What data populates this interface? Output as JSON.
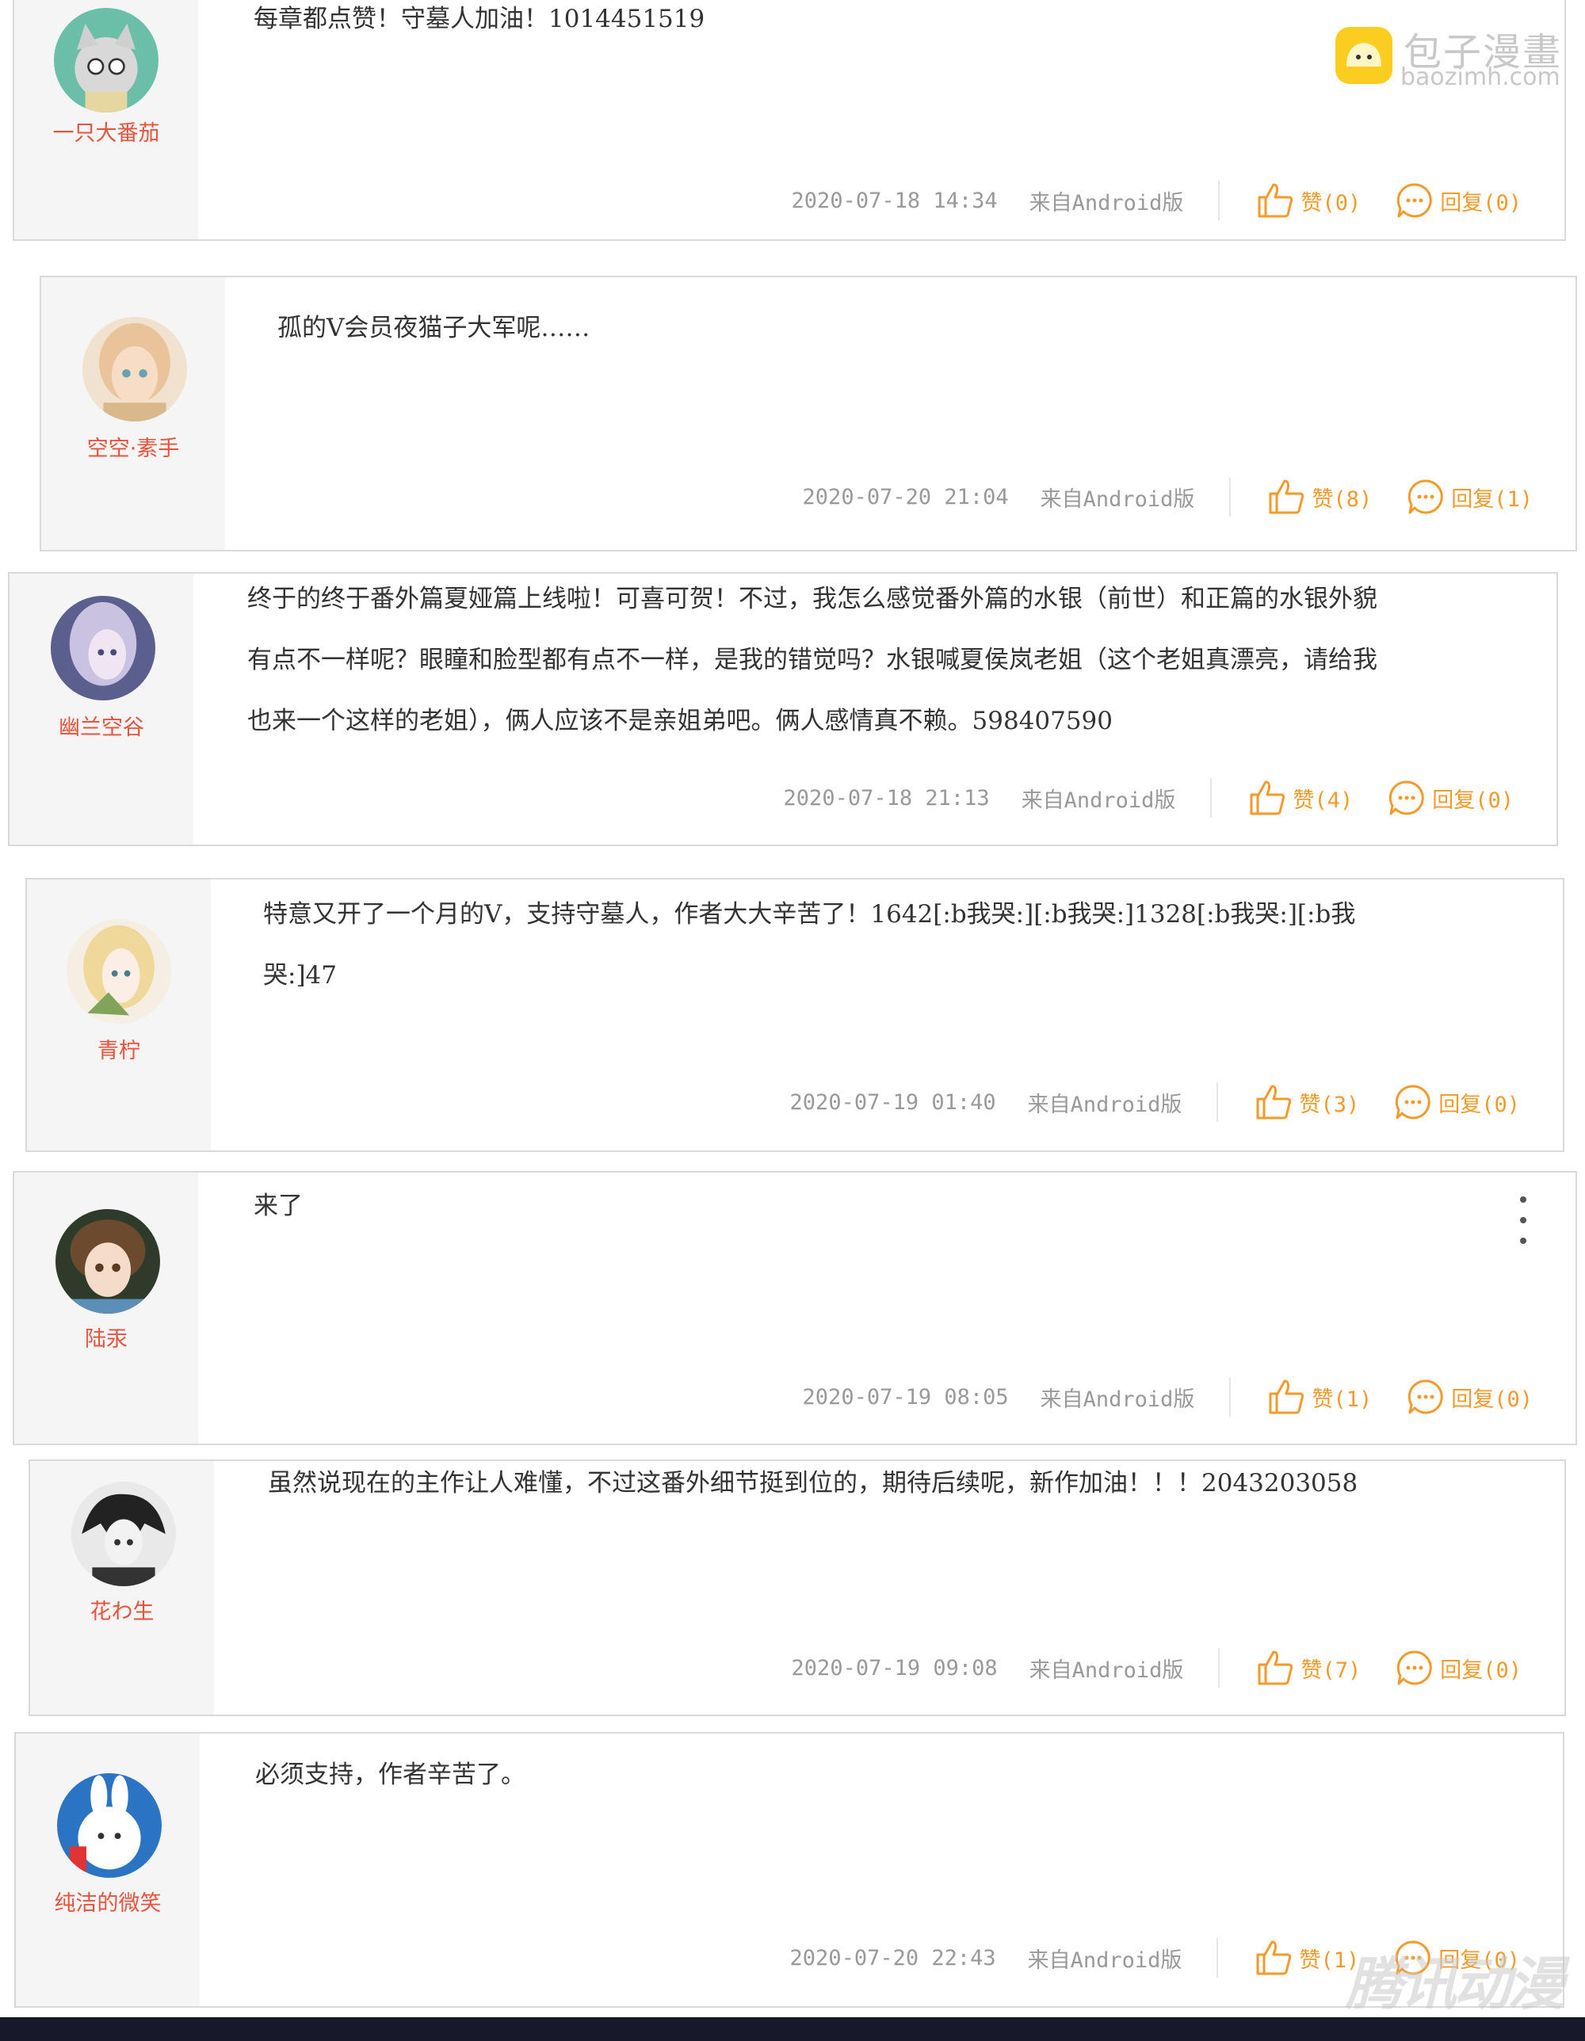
{
  "watermark": {
    "title": "包子漫畫",
    "url": "baozimh.com",
    "corner_mark": "腾讯动漫"
  },
  "comments": [
    {
      "user": "一只大番茄",
      "text": [
        "每章都点赞！守墓人加油！1014451519"
      ],
      "date": "2020-07-18 14:34",
      "source": "来自Android版",
      "like": "赞(0)",
      "reply": "回复(0)"
    },
    {
      "user": "空空·素手",
      "text": [
        "孤的V会员夜猫子大军呢……"
      ],
      "date": "2020-07-20 21:04",
      "source": "来自Android版",
      "like": "赞(8)",
      "reply": "回复(1)"
    },
    {
      "user": "幽兰空谷",
      "text": [
        "终于的终于番外篇夏娅篇上线啦！可喜可贺！不过，我怎么感觉番外篇的水银（前世）和正篇的水银外貌",
        "有点不一样呢？眼瞳和脸型都有点不一样，是我的错觉吗？水银喊夏侯岚老姐（这个老姐真漂亮，请给我",
        "也来一个这样的老姐），俩人应该不是亲姐弟吧。俩人感情真不赖。598407590"
      ],
      "date": "2020-07-18 21:13",
      "source": "来自Android版",
      "like": "赞(4)",
      "reply": "回复(0)"
    },
    {
      "user": "青柠",
      "text": [
        "特意又开了一个月的V，支持守墓人，作者大大辛苦了！1642[:b我哭:][:b我哭:]1328[:b我哭:][:b我",
        "哭:]47"
      ],
      "date": "2020-07-19 01:40",
      "source": "来自Android版",
      "like": "赞(3)",
      "reply": "回复(0)"
    },
    {
      "user": "陆汞",
      "text": [
        "来了"
      ],
      "date": "2020-07-19 08:05",
      "source": "来自Android版",
      "like": "赞(1)",
      "reply": "回复(0)"
    },
    {
      "user": "花わ生",
      "text": [
        "虽然说现在的主作让人难懂，不过这番外细节挺到位的，期待后续呢，新作加油！！！2043203058"
      ],
      "date": "2020-07-19 09:08",
      "source": "来自Android版",
      "like": "赞(7)",
      "reply": "回复(0)"
    },
    {
      "user": "纯洁的微笑",
      "text": [
        "必须支持，作者辛苦了。"
      ],
      "date": "2020-07-20 22:43",
      "source": "来自Android版",
      "like": "赞(1)",
      "reply": "回复(0)"
    }
  ]
}
